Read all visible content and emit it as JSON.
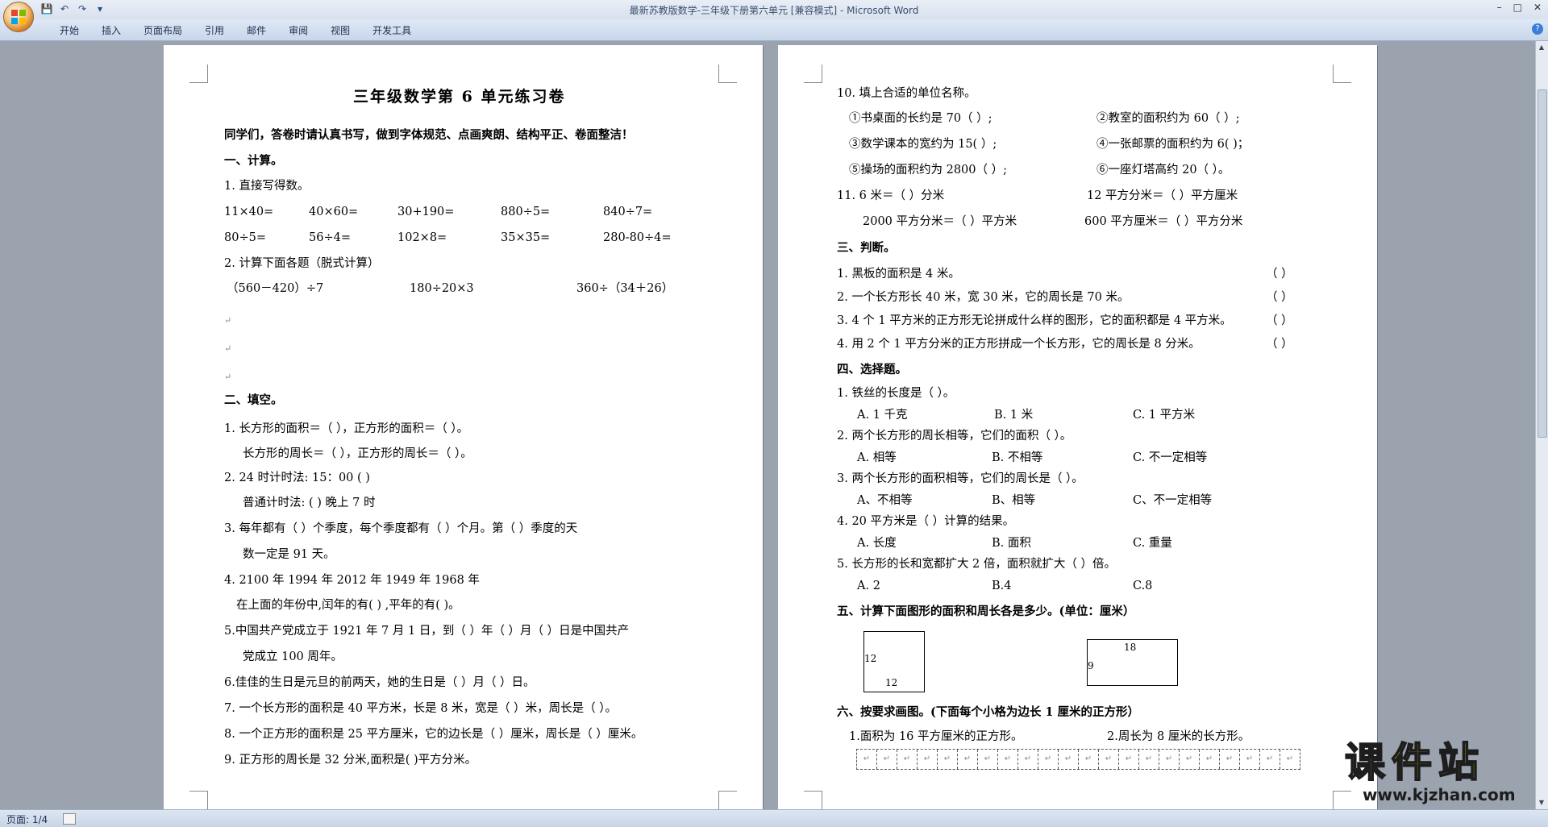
{
  "window": {
    "title": "最新苏教版数学-三年级下册第六单元 [兼容模式] - Microsoft Word",
    "min": "–",
    "max": "□",
    "close": "✕"
  },
  "qat": {
    "save": "💾",
    "undo": "↶",
    "redo": "↷",
    "more": "▾"
  },
  "ribbon": {
    "tabs": [
      "开始",
      "插入",
      "页面布局",
      "引用",
      "邮件",
      "审阅",
      "视图",
      "开发工具"
    ],
    "help": "?"
  },
  "status": {
    "page": "页面: 1/4"
  },
  "mark": "↵",
  "page1": {
    "title": "三年级数学第 6 单元练习卷",
    "intro": "同学们，答卷时请认真书写，做到字体规范、点画爽朗、结构平正、卷面整洁！",
    "s1": "一、计算。",
    "q1": "1. 直接写得数。",
    "calc": [
      [
        "11×40=",
        "40×60=",
        "30+190=",
        "880÷5=",
        "840÷7="
      ],
      [
        "80÷5=",
        "56÷4=",
        "102×8=",
        "35×35=",
        "280-80÷4="
      ]
    ],
    "q2": "2. 计算下面各题（脱式计算）",
    "q2items": [
      "（560－420）÷7",
      "180÷20×3",
      "360÷（34＋26）"
    ],
    "s2": "二、填空。",
    "f1a": "1. 长方形的面积＝（                ），正方形的面积＝（                ）。",
    "f1b": "长方形的周长＝（                ），正方形的周长＝（                ）。",
    "f2a": "2. 24 时计时法:              15：00                    (              )",
    "f2b": "普通计时法:              (              )                    晚上 7 时",
    "f3a": "3. 每年都有（      ）个季度，每个季度都有（      ）个月。第（    ）季度的天",
    "f3b": "数一定是 91 天。",
    "f4a": "4. 2100 年      1994 年      2012 年      1949 年      1968 年",
    "f4b": "在上面的年份中,闰年的有(                              ) ,平年的有(                    )。",
    "f5a": "5.中国共产党成立于 1921 年 7 月 1 日，到（    ）年（    ）月（    ）日是中国共产",
    "f5b": "党成立 100 周年。",
    "f6": "6.佳佳的生日是元旦的前两天，她的生日是（    ）月（    ）日。",
    "f7": "7. 一个长方形的面积是 40 平方米，长是 8 米，宽是（    ）米，周长是（          ）。",
    "f8": "8. 一个正方形的面积是 25 平方厘米，它的边长是（    ）厘米，周长是（    ）厘米。",
    "f9": "9. 正方形的周长是 32 分米,面积是(      )平方分米。"
  },
  "page2": {
    "q10": "10. 填上合适的单位名称。",
    "u1": "①书桌面的长约是 70（          ）;",
    "u2": "②教室的面积约为 60（          ）;",
    "u3": "③数学课本的宽约为 15(          ）;",
    "u4": "④一张邮票的面积约为 6(          )；",
    "u5": "⑤操场的面积约为 2800（          ）;",
    "u6": "⑥一座灯塔高约 20（          ）。",
    "c1": "11. 6 米＝（      ）分米",
    "c2": "12 平方分米＝（      ）平方厘米",
    "c3": "2000 平方分米＝（      ）平方米",
    "c4": "600 平方厘米＝（        ）平方分米",
    "s3": "三、判断。",
    "j1": "1. 黑板的面积是 4 米。",
    "j2": "2. 一个长方形长 40 米，宽 30 米，它的周长是 70 米。",
    "j3": "3. 4 个 1 平方米的正方形无论拼成什么样的图形，它的面积都是 4 平方米。",
    "j4": "4. 用 2 个 1 平方分米的正方形拼成一个长方形，它的周长是 8 分米。",
    "paren": "（      ）",
    "s4": "四、选择题。",
    "m1": "1. 铁丝的长度是（    ）。",
    "m1o": [
      "A. 1 千克",
      "B. 1 米",
      "C. 1 平方米"
    ],
    "m2": "2. 两个长方形的周长相等，它们的面积（    ）。",
    "m2o": [
      "A. 相等",
      "B. 不相等",
      "C. 不一定相等"
    ],
    "m3": "3. 两个长方形的面积相等，它们的周长是（    ）。",
    "m3o": [
      "A、不相等",
      "B、相等",
      "C、不一定相等"
    ],
    "m4": "4. 20 平方米是（    ）计算的结果。",
    "m4o": [
      "A. 长度",
      "B. 面积",
      "C. 重量"
    ],
    "m5": "5. 长方形的长和宽都扩大 2 倍，面积就扩大（    ）倍。",
    "m5o": [
      "A. 2",
      "B.4",
      "C.8"
    ],
    "s5": "五、计算下面图形的面积和周长各是多少。(单位：厘米）",
    "sq_side": "12",
    "sq_bottom": "12",
    "rect_top": "18",
    "rect_side": "9",
    "s6": "六、按要求画图。(下面每个小格为边长 1 厘米的正方形）",
    "d1": "1.面积为 16 平方厘米的正方形。",
    "d2": "2.周长为 8 厘米的长方形。"
  },
  "watermark": {
    "cn": "课件站",
    "url": "www.kjzhan.com"
  }
}
